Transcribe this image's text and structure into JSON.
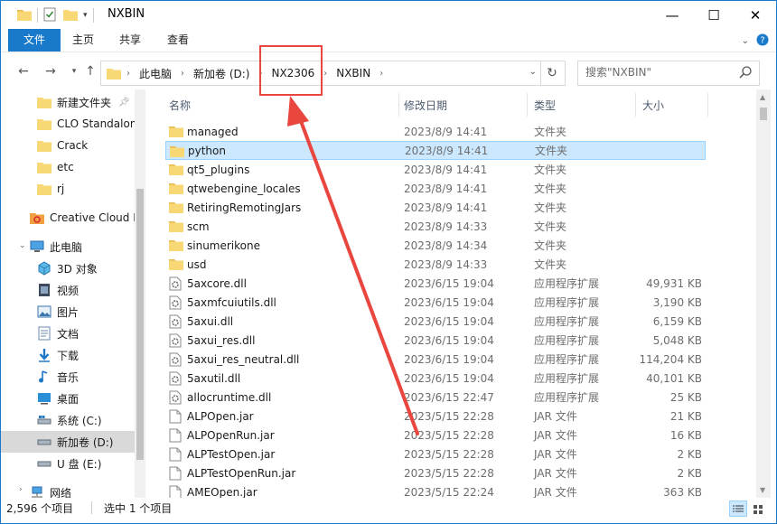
{
  "window": {
    "title": "NXBIN",
    "controls": [
      "minimize-icon",
      "maximize-icon",
      "close-icon"
    ]
  },
  "ribbon": {
    "tabs": [
      "文件",
      "主页",
      "共享",
      "查看"
    ]
  },
  "address": {
    "breadcrumbs": [
      "此电脑",
      "新加卷 (D:)",
      "NX2306",
      "NXBIN"
    ],
    "search_placeholder": "搜索\"NXBIN\""
  },
  "nav_pane": {
    "quick_access": [
      {
        "label": "新建文件夹",
        "pinned": true
      },
      {
        "label": "CLO Standalon",
        "pinned": false
      },
      {
        "label": "Crack",
        "pinned": false
      },
      {
        "label": "etc",
        "pinned": false
      },
      {
        "label": "rj",
        "pinned": false
      }
    ],
    "creative_cloud": "Creative Cloud F",
    "this_pc": "此电脑",
    "pc_items": [
      {
        "label": "3D 对象",
        "icon": "3d-objects-icon"
      },
      {
        "label": "视频",
        "icon": "video-icon"
      },
      {
        "label": "图片",
        "icon": "pictures-icon"
      },
      {
        "label": "文档",
        "icon": "documents-icon"
      },
      {
        "label": "下载",
        "icon": "download-icon"
      },
      {
        "label": "音乐",
        "icon": "music-icon"
      },
      {
        "label": "桌面",
        "icon": "desktop-icon"
      },
      {
        "label": "系统 (C:)",
        "icon": "system-drive-icon"
      },
      {
        "label": "新加卷 (D:)",
        "icon": "drive-icon"
      },
      {
        "label": "U 盘 (E:)",
        "icon": "usb-drive-icon"
      }
    ],
    "network": "网络"
  },
  "columns": {
    "name": "名称",
    "date": "修改日期",
    "type": "类型",
    "size": "大小"
  },
  "files": [
    {
      "name": "managed",
      "date": "2023/8/9 14:41",
      "type": "文件夹",
      "size": "",
      "kind": "folder"
    },
    {
      "name": "python",
      "date": "2023/8/9 14:41",
      "type": "文件夹",
      "size": "",
      "kind": "folder"
    },
    {
      "name": "qt5_plugins",
      "date": "2023/8/9 14:41",
      "type": "文件夹",
      "size": "",
      "kind": "folder"
    },
    {
      "name": "qtwebengine_locales",
      "date": "2023/8/9 14:41",
      "type": "文件夹",
      "size": "",
      "kind": "folder"
    },
    {
      "name": "RetiringRemotingJars",
      "date": "2023/8/9 14:41",
      "type": "文件夹",
      "size": "",
      "kind": "folder"
    },
    {
      "name": "scm",
      "date": "2023/8/9 14:33",
      "type": "文件夹",
      "size": "",
      "kind": "folder"
    },
    {
      "name": "sinumerikone",
      "date": "2023/8/9 14:34",
      "type": "文件夹",
      "size": "",
      "kind": "folder"
    },
    {
      "name": "usd",
      "date": "2023/8/9 14:33",
      "type": "文件夹",
      "size": "",
      "kind": "folder"
    },
    {
      "name": "5axcore.dll",
      "date": "2023/6/15 19:04",
      "type": "应用程序扩展",
      "size": "49,931 KB",
      "kind": "dll"
    },
    {
      "name": "5axmfcuiutils.dll",
      "date": "2023/6/15 19:04",
      "type": "应用程序扩展",
      "size": "3,190 KB",
      "kind": "dll"
    },
    {
      "name": "5axui.dll",
      "date": "2023/6/15 19:04",
      "type": "应用程序扩展",
      "size": "6,159 KB",
      "kind": "dll"
    },
    {
      "name": "5axui_res.dll",
      "date": "2023/6/15 19:04",
      "type": "应用程序扩展",
      "size": "5,048 KB",
      "kind": "dll"
    },
    {
      "name": "5axui_res_neutral.dll",
      "date": "2023/6/15 19:04",
      "type": "应用程序扩展",
      "size": "114,204 KB",
      "kind": "dll"
    },
    {
      "name": "5axutil.dll",
      "date": "2023/6/15 19:04",
      "type": "应用程序扩展",
      "size": "40,101 KB",
      "kind": "dll"
    },
    {
      "name": "allocruntime.dll",
      "date": "2023/6/15 22:47",
      "type": "应用程序扩展",
      "size": "25 KB",
      "kind": "dll"
    },
    {
      "name": "ALPOpen.jar",
      "date": "2023/5/15 22:28",
      "type": "JAR 文件",
      "size": "21 KB",
      "kind": "file"
    },
    {
      "name": "ALPOpenRun.jar",
      "date": "2023/5/15 22:28",
      "type": "JAR 文件",
      "size": "16 KB",
      "kind": "file"
    },
    {
      "name": "ALPTestOpen.jar",
      "date": "2023/5/15 22:28",
      "type": "JAR 文件",
      "size": "2 KB",
      "kind": "file"
    },
    {
      "name": "ALPTestOpenRun.jar",
      "date": "2023/5/15 22:28",
      "type": "JAR 文件",
      "size": "2 KB",
      "kind": "file"
    },
    {
      "name": "AMEOpen.jar",
      "date": "2023/5/15 22:24",
      "type": "JAR 文件",
      "size": "363 KB",
      "kind": "file"
    }
  ],
  "selected_index": 1,
  "status": {
    "item_count": "2,596 个项目",
    "selected": "选中 1 个项目"
  },
  "colors": {
    "accent": "#1979ca",
    "selection": "#cce8ff",
    "folder": "#f8d775",
    "annotation_red": "#e8463f"
  }
}
